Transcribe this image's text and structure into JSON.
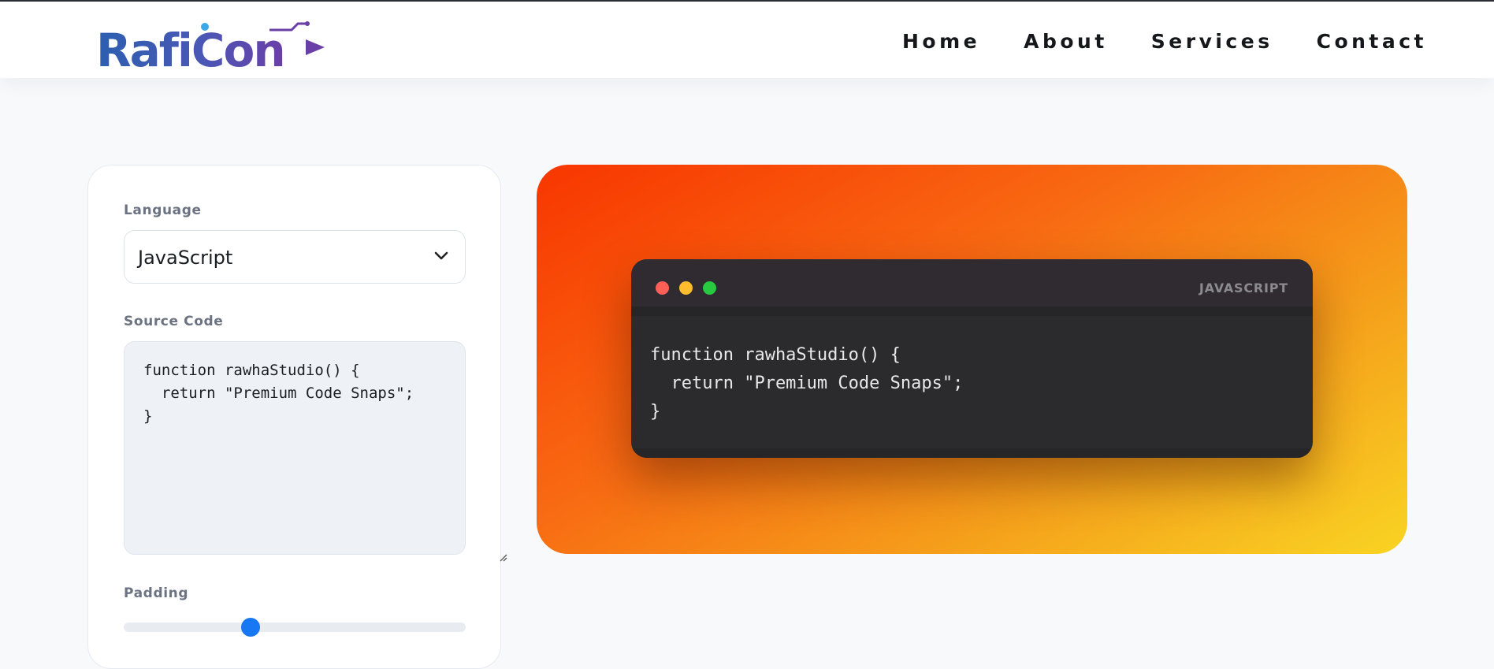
{
  "header": {
    "logo_text": "RafiCon",
    "nav": [
      "Home",
      "About",
      "Services",
      "Contact"
    ]
  },
  "controls": {
    "language_label": "Language",
    "language_value": "JavaScript",
    "source_label": "Source Code",
    "source_code": "function rawhaStudio() {\n  return \"Premium Code Snaps\";\n}",
    "padding_label": "Padding",
    "padding_fraction": 0.37
  },
  "preview": {
    "language_badge": "JAVASCRIPT",
    "code": "function rawhaStudio() {\n  return \"Premium Code Snaps\";\n}",
    "gradient_colors": [
      "#f83600",
      "#f9d423"
    ],
    "dot_colors": [
      "#ff5f57",
      "#febc2e",
      "#28c840"
    ]
  },
  "colors": {
    "accent": "#1877f2",
    "logo_primary": "#2c5fb0",
    "logo_secondary": "#6a3fa8"
  }
}
